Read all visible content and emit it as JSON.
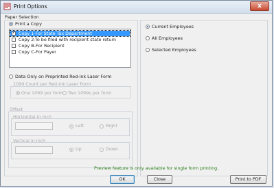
{
  "window": {
    "title": "Print Options",
    "close_glyph": "x"
  },
  "paper_selection": {
    "group_label": "Paper Selection",
    "print_copy_label": "Print a Copy",
    "copies": [
      {
        "label": "Copy 1-For State Tax Department",
        "checked": true,
        "selected": true
      },
      {
        "label": "Copy 2-To be filed with recipient state return",
        "checked": false,
        "selected": false
      },
      {
        "label": "Copy B-For Recipient",
        "checked": false,
        "selected": false
      },
      {
        "label": "Copy C-For Payer",
        "checked": false,
        "selected": false
      }
    ],
    "preprinted_label": "Data Only on Preprinted Red-ink Laser Form",
    "count_group_label": "1099 Count per Red-ink Laser Form",
    "one_per_form_label": "One 1099 per form",
    "two_per_form_label": "Two 1099s per form"
  },
  "offset": {
    "group_label": "Offset",
    "horizontal_label": "Horizontal in Inch",
    "left_label": "Left",
    "right_label": "Right",
    "vertical_label": "Vertical in Inch",
    "up_label": "Up",
    "down_label": "Down"
  },
  "employees": {
    "current_label": "Current Employees",
    "all_label": "All Employees",
    "selected_label": "Selected Employees"
  },
  "preview_note": "Preview feature is only available for single form printing.",
  "buttons": {
    "ok": "OK",
    "close": "Close",
    "print_pdf": "Print to PDF"
  },
  "colors": {
    "note": "#2a7d1b",
    "selection": "#3399ff"
  }
}
